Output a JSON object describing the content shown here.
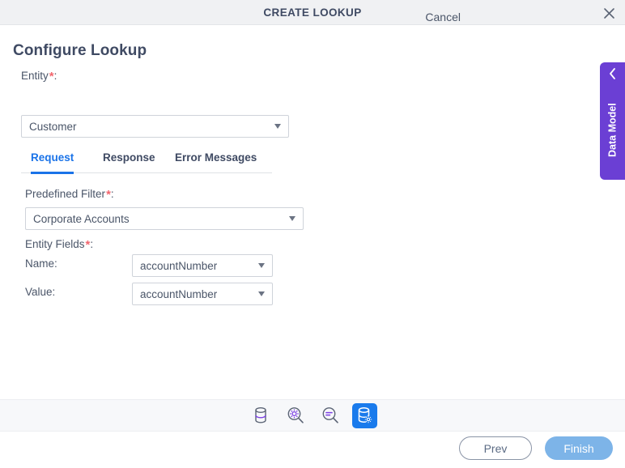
{
  "window": {
    "title": "CREATE LOOKUP",
    "close_icon": "close-icon"
  },
  "page": {
    "heading": "Configure Lookup"
  },
  "entity": {
    "label": "Entity",
    "required_marker": "*",
    "colon": ":",
    "value": "Customer"
  },
  "tabs": [
    {
      "label": "Request",
      "active": true
    },
    {
      "label": "Response",
      "active": false
    },
    {
      "label": "Error Messages",
      "active": false
    }
  ],
  "request_panel": {
    "predefined_filter": {
      "label": "Predefined Filter",
      "required_marker": "*",
      "colon": ":",
      "value": "Corporate Accounts"
    },
    "entity_fields": {
      "label": "Entity Fields",
      "required_marker": "*",
      "colon": ":",
      "rows": [
        {
          "label": "Name:",
          "value": "accountNumber"
        },
        {
          "label": "Value:",
          "value": "accountNumber"
        }
      ]
    }
  },
  "toolbar": {
    "items": [
      {
        "icon": "database-icon",
        "active": false
      },
      {
        "icon": "search-settings-icon",
        "active": false
      },
      {
        "icon": "search-filter-icon",
        "active": false
      },
      {
        "icon": "database-settings-icon",
        "active": true
      }
    ]
  },
  "footer": {
    "cancel_label": "Cancel",
    "prev_label": "Prev",
    "finish_label": "Finish"
  },
  "side_tab": {
    "label": "Data Model",
    "chevron_icon": "chevron-left-icon"
  },
  "colors": {
    "accent_blue": "#1a73e8",
    "toolbar_active_blue": "#1a7bec",
    "finish_blue": "#7db4e8",
    "side_tab_purple": "#6b3fd4",
    "required_red": "#f2666e",
    "icon_purple": "#7b3fe4",
    "icon_gray": "#5b6475",
    "titlebar_bg": "#f0f1f3",
    "toolbar_bg": "#f7f8fa"
  }
}
